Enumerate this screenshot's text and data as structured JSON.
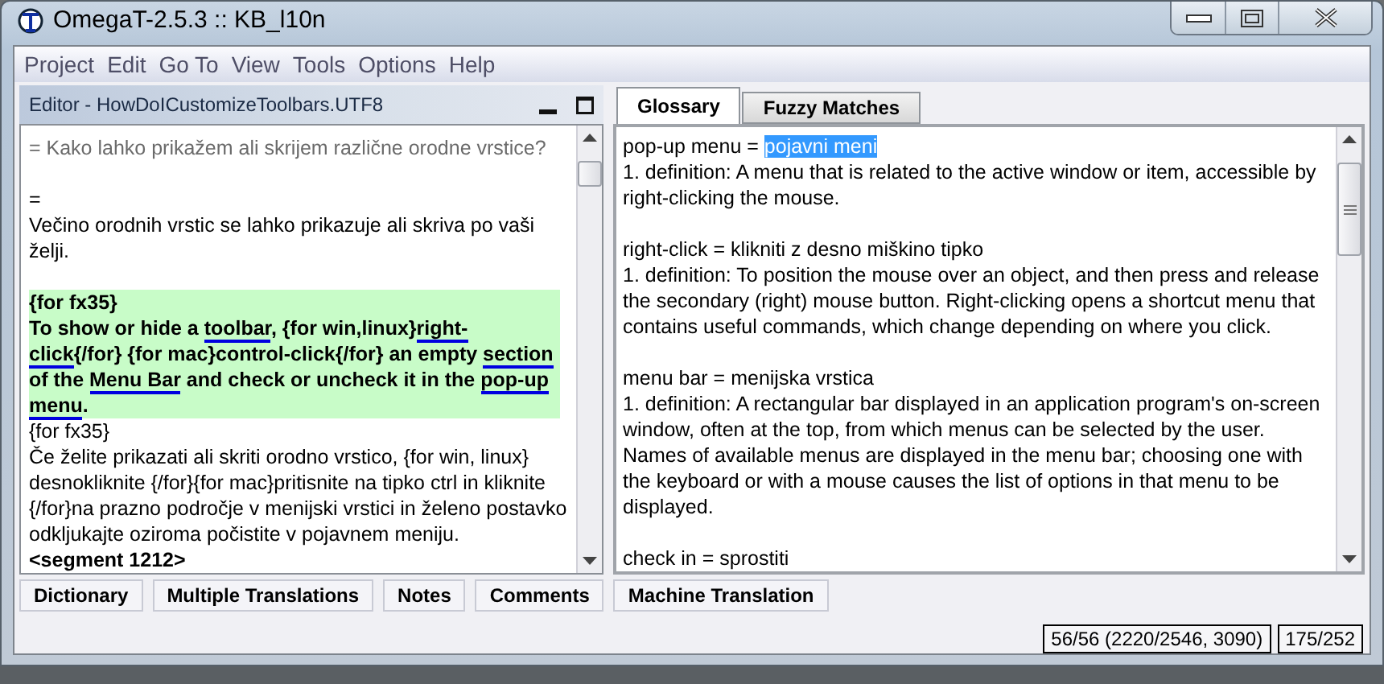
{
  "window": {
    "title": "OmegaT-2.5.3 :: KB_l10n"
  },
  "menu": [
    "Project",
    "Edit",
    "Go To",
    "View",
    "Tools",
    "Options",
    "Help"
  ],
  "editor": {
    "title": "Editor - HowDoICustomizeToolbars.UTF8",
    "segments": [
      {
        "kind": "source",
        "lines": [
          "= Kako lahko prikažem ali skrijem različne orodne vrstice?"
        ]
      },
      {
        "kind": "plain",
        "lines": [
          "=",
          "Večino orodnih vrstic se lahko prikazuje ali skriva po vaši želji."
        ]
      },
      {
        "kind": "active",
        "lines": [
          "{for fx35}"
        ],
        "parts": [
          {
            "text": "To show or hide a ",
            "term": false
          },
          {
            "text": "toolbar",
            "term": true
          },
          {
            "text": ", {for win,linux}",
            "term": false
          },
          {
            "text": "right-click",
            "term": true
          },
          {
            "text": "{/for} {for mac}control-click{/for} an empty ",
            "term": false
          },
          {
            "text": "section",
            "term": true
          },
          {
            "text": " of the ",
            "term": false
          },
          {
            "text": "Menu Bar",
            "term": true
          },
          {
            "text": " and check or uncheck it in the ",
            "term": false
          },
          {
            "text": "pop-up menu",
            "term": true
          },
          {
            "text": ".",
            "term": false
          }
        ]
      },
      {
        "kind": "plain",
        "lines": [
          "{for fx35}",
          "Če želite prikazati ali skriti orodno vrstico, {for win, linux} desnokliknite {/for}{for mac}pritisnite na tipko ctrl in kliknite {/for}na prazno področje v menijski vrstici in želeno postavko odkljukajte oziroma počistite v pojavnem meniju."
        ]
      },
      {
        "kind": "marker",
        "lines": [
          "<segment 1212>"
        ]
      }
    ]
  },
  "right_tabs": [
    {
      "label": "Glossary",
      "selected": true
    },
    {
      "label": "Fuzzy Matches",
      "selected": false
    }
  ],
  "glossary": [
    {
      "term": "pop-up menu =",
      "translation": "pojavni meni",
      "selected": true,
      "definition": "1. definition: A menu that is related to the active window or item, accessible by right-clicking the mouse."
    },
    {
      "term": "right-click =",
      "translation": "klikniti z desno miškino tipko",
      "selected": false,
      "definition": "1. definition: To position the mouse over an object, and then press and release the secondary (right) mouse button. Right-clicking opens a shortcut menu that contains useful commands, which change depending on where you click."
    },
    {
      "term": "menu bar =",
      "translation": "menijska vrstica",
      "selected": false,
      "definition": "1. definition: A rectangular bar displayed in an application program's on-screen window, often at the top, from which menus can be selected by the user. Names of available menus are displayed in the menu bar; choosing one with the keyboard or with a mouse causes the list of options in that menu to be displayed."
    },
    {
      "term": "check in =",
      "translation": "sprostiti",
      "selected": false
    }
  ],
  "bottom_tabs": [
    "Dictionary",
    "Multiple Translations",
    "Notes",
    "Comments",
    "Machine Translation"
  ],
  "status_bar": [
    "56/56 (2220/2546, 3090)",
    "175/252"
  ]
}
